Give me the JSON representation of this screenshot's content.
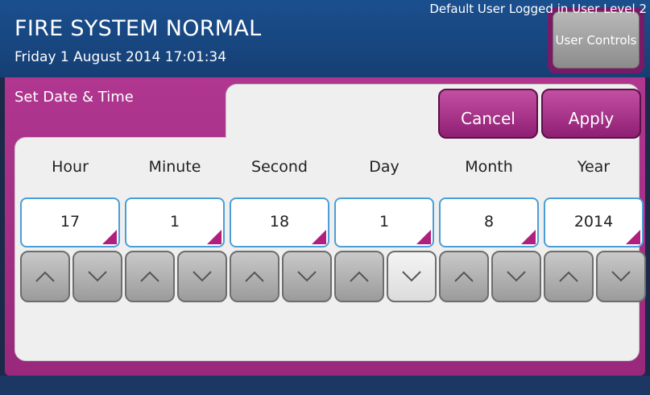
{
  "header": {
    "title": "FIRE SYSTEM NORMAL",
    "datetime": "Friday 1 August 2014 17:01:34",
    "user_controls_label": "User Controls"
  },
  "panel": {
    "title": "Set Date & Time",
    "cancel_label": "Cancel",
    "apply_label": "Apply"
  },
  "fields": [
    {
      "label": "Hour",
      "value": "17"
    },
    {
      "label": "Minute",
      "value": "1"
    },
    {
      "label": "Second",
      "value": "18"
    },
    {
      "label": "Day",
      "value": "1"
    },
    {
      "label": "Month",
      "value": "8"
    },
    {
      "label": "Year",
      "value": "2014"
    }
  ],
  "arrows": {
    "up_icon": "chevron-up-icon",
    "down_icon": "chevron-down-icon"
  },
  "footer": {
    "status": "Default User Logged in User Level 2"
  },
  "colors": {
    "header_blue": "#1a4f8e",
    "panel_magenta": "#b0368f",
    "field_border_blue": "#4a9fd6",
    "corner_magenta": "#b01f7e"
  }
}
